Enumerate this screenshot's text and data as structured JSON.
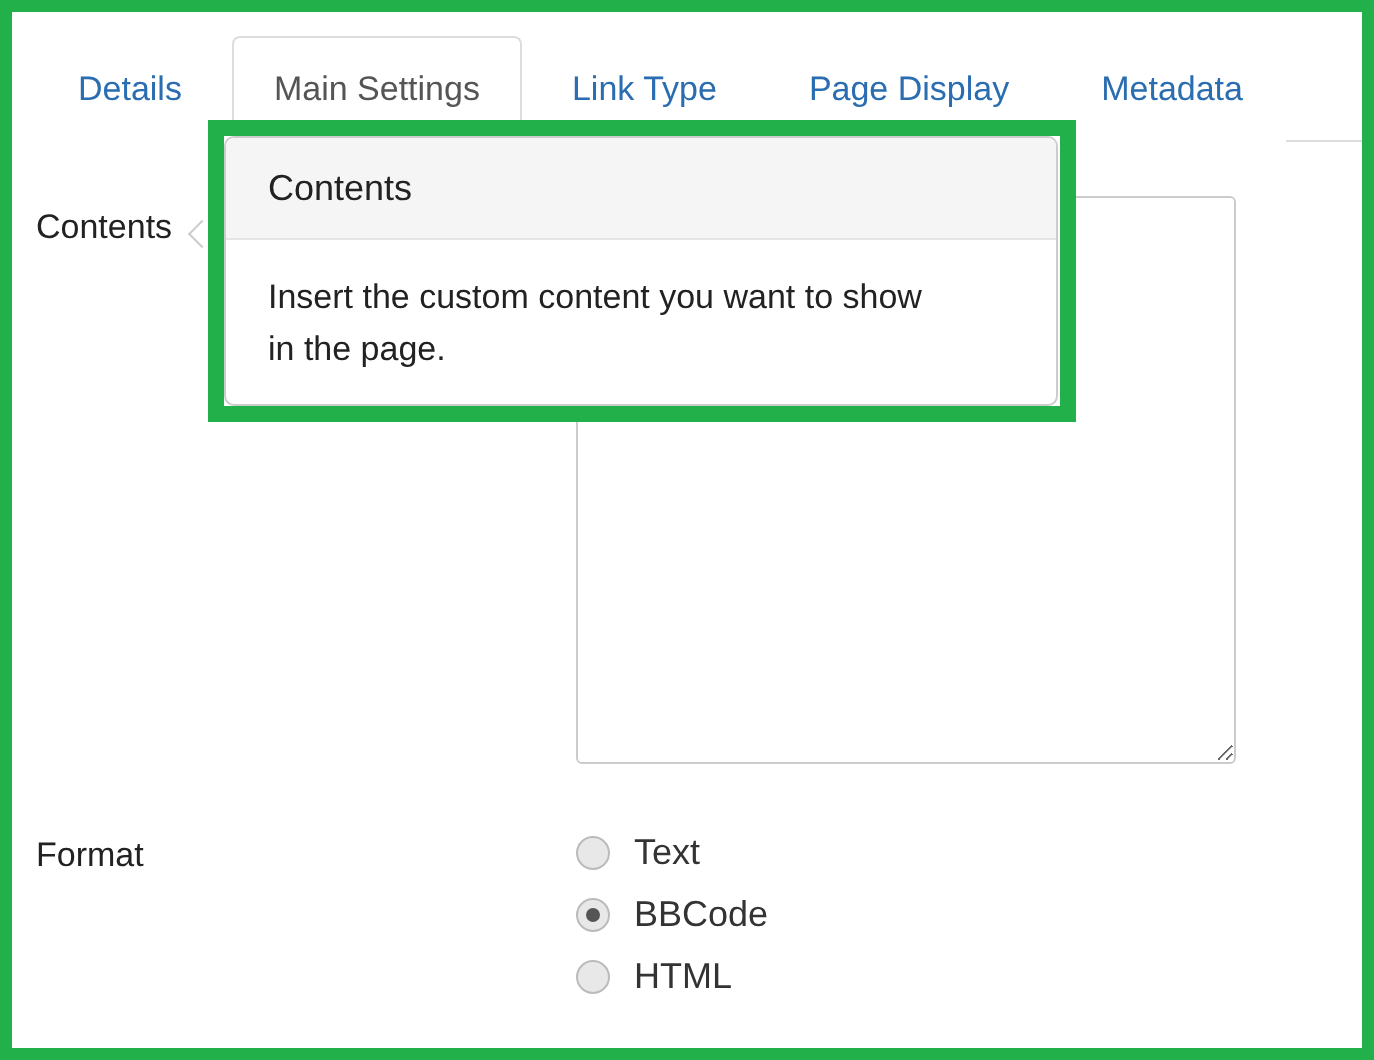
{
  "tabs": [
    {
      "label": "Details",
      "selected": false
    },
    {
      "label": "Main Settings",
      "selected": true
    },
    {
      "label": "Link Type",
      "selected": false
    },
    {
      "label": "Page Display",
      "selected": false
    },
    {
      "label": "Metadata",
      "selected": false
    }
  ],
  "fields": [
    {
      "label": "Contents",
      "kind": "textarea"
    },
    {
      "label": "Format",
      "kind": "radios",
      "options": [
        {
          "label": "Text",
          "selected": false
        },
        {
          "label": "BBCode",
          "selected": true
        },
        {
          "label": "HTML",
          "selected": false
        }
      ]
    }
  ],
  "popover": {
    "title": "Contents",
    "body": "Insert the custom content you want to show in the page."
  }
}
